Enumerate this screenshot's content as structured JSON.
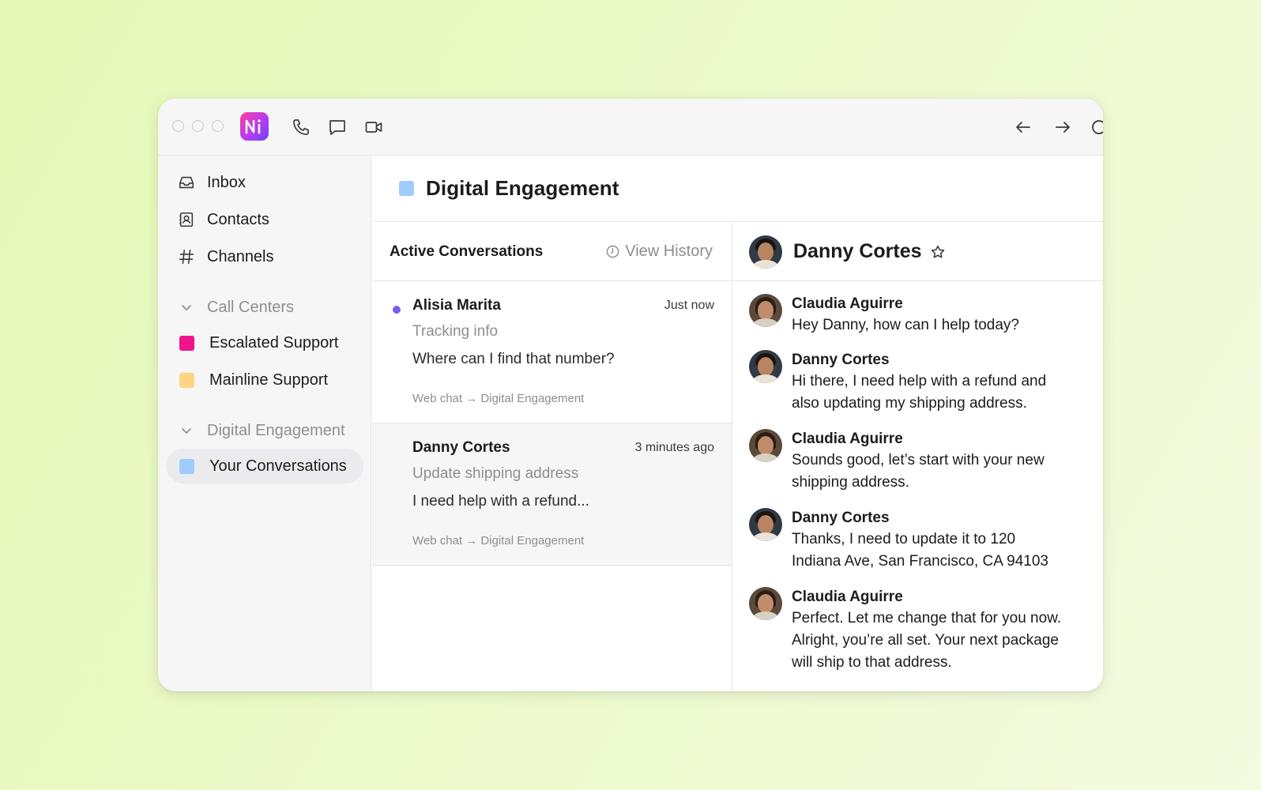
{
  "titlebar": {
    "logo_text": "Ni",
    "icons": [
      "phone-icon",
      "chat-bubble-icon",
      "video-icon",
      "arrow-left-icon",
      "arrow-right-icon",
      "refresh-icon"
    ]
  },
  "sidebar": {
    "items": [
      {
        "label": "Inbox",
        "icon": "inbox-icon"
      },
      {
        "label": "Contacts",
        "icon": "contacts-icon"
      },
      {
        "label": "Channels",
        "icon": "hash-icon"
      }
    ],
    "sections": [
      {
        "label": "Call Centers",
        "items": [
          {
            "label": "Escalated Support",
            "color": "#f0148c"
          },
          {
            "label": "Mainline Support",
            "color": "#ffd584"
          }
        ]
      },
      {
        "label": "Digital Engagement",
        "items": [
          {
            "label": "Your Conversations",
            "color": "#9fccff",
            "active": true
          }
        ]
      }
    ]
  },
  "main": {
    "title": "Digital Engagement",
    "title_color": "#9fccff"
  },
  "conversations": {
    "heading": "Active Conversations",
    "view_history": "View History",
    "items": [
      {
        "name": "Alisia Marita",
        "time": "Just now",
        "subject": "Tracking info",
        "preview": "Where can I find that number?",
        "route": "Web chat → Digital Engagement",
        "unread": true
      },
      {
        "name": "Danny Cortes",
        "time": "3 minutes ago",
        "subject": "Update shipping address",
        "preview": "I need help with a refund...",
        "route": "Web chat → Digital Engagement",
        "unread": false
      }
    ]
  },
  "chat": {
    "contact_name": "Danny Cortes",
    "messages": [
      {
        "author": "Claudia Aguirre",
        "text": "Hey Danny, how can I help today?"
      },
      {
        "author": "Danny Cortes",
        "text": "Hi there, I need help with a refund and also updating my shipping address."
      },
      {
        "author": "Claudia Aguirre",
        "text": "Sounds good, let’s start with your new shipping address."
      },
      {
        "author": "Danny Cortes",
        "text": "Thanks, I need to update it to 120 Indiana Ave, San Francisco, CA 94103"
      },
      {
        "author": "Claudia Aguirre",
        "text": "Perfect. Let me change that for you now. Alright, you’re all set. Your next package will ship to that address."
      }
    ]
  },
  "colors": {
    "unread_dot": "#7b5cf0",
    "logo_gradient_start": "#ff3d9a",
    "logo_gradient_end": "#6b45f5"
  }
}
